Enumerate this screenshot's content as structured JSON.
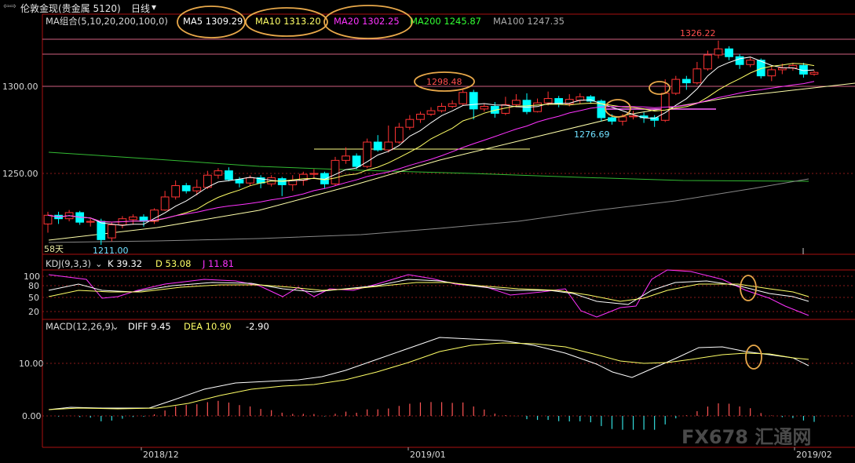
{
  "window": {
    "nav_arrows": "⇦⇨",
    "title": "伦敦金现(贵金属 5120)",
    "period": "日线",
    "period_caret": "▾"
  },
  "price_panel": {
    "ma_label": "MA组合(5,10,20,200,100,0)",
    "ma_items": [
      {
        "label": "MA5",
        "value": "1309.29",
        "color": "#ffffff"
      },
      {
        "label": "MA10",
        "value": "1313.20",
        "color": "#ffff66"
      },
      {
        "label": "MA20",
        "value": "1302.25",
        "color": "#ff33ff"
      },
      {
        "label": "MA200",
        "value": "1245.87",
        "color": "#33ff33"
      },
      {
        "label": "MA100",
        "value": "1247.35",
        "color": "#aaaaaa"
      }
    ],
    "y_ticks": [
      "1300.00",
      "1250.00"
    ],
    "annotations": {
      "high": "1326.22",
      "peak1": "1298.48",
      "low_mid": "1276.69",
      "low": "1211.00",
      "days": "58天"
    }
  },
  "kdj_panel": {
    "label": "KDJ(9,3,3)",
    "k": "K 39.32",
    "d": "D 53.08",
    "j": "J 11.81",
    "y_ticks": [
      "100",
      "80",
      "50",
      "20"
    ]
  },
  "macd_panel": {
    "label": "MACD(12,26,9)",
    "diff": "DIFF 9.45",
    "dea": "DEA 10.90",
    "macd": "-2.90",
    "y_ticks": [
      "10.00",
      "0.00"
    ]
  },
  "x_axis": {
    "labels": [
      "2018/12",
      "2019/01",
      "2019/02"
    ]
  },
  "watermark": "FX678 汇通网",
  "colors": {
    "up": "#ff3333",
    "down": "#00ffff",
    "bg": "#000000",
    "grid": "#8b0000",
    "highlight": "#e8a84a"
  },
  "chart_data": {
    "type": "candlestick",
    "ylim": [
      1195,
      1340
    ],
    "candles": [
      [
        1221.0,
        1226.0,
        1216.0,
        1228.0
      ],
      [
        1226.0,
        1224.0,
        1221.0,
        1228.0
      ],
      [
        1224.0,
        1227.5,
        1222.5,
        1229.0
      ],
      [
        1227.5,
        1222.0,
        1220.5,
        1228.5
      ],
      [
        1222.0,
        1222.5,
        1219.5,
        1224.0
      ],
      [
        1222.5,
        1212.0,
        1209.0,
        1224.0
      ],
      [
        1213.0,
        1220.5,
        1211.0,
        1222.0
      ],
      [
        1220.5,
        1224.0,
        1218.5,
        1225.5
      ],
      [
        1223.5,
        1225.0,
        1220.5,
        1226.5
      ],
      [
        1225.0,
        1222.5,
        1219.5,
        1226.5
      ],
      [
        1222.5,
        1229.0,
        1221.0,
        1230.0
      ],
      [
        1229.0,
        1236.5,
        1228.5,
        1240.0
      ],
      [
        1236.5,
        1243.0,
        1235.0,
        1246.0
      ],
      [
        1243.0,
        1240.0,
        1238.5,
        1244.5
      ],
      [
        1240.0,
        1242.0,
        1237.5,
        1246.5
      ],
      [
        1242.0,
        1249.0,
        1241.0,
        1251.5
      ],
      [
        1249.0,
        1251.5,
        1247.0,
        1253.0
      ],
      [
        1251.5,
        1246.5,
        1245.5,
        1253.5
      ],
      [
        1246.5,
        1244.5,
        1242.0,
        1248.0
      ],
      [
        1244.5,
        1247.5,
        1243.0,
        1249.0
      ],
      [
        1247.5,
        1244.5,
        1241.5,
        1249.0
      ],
      [
        1244.0,
        1247.5,
        1242.5,
        1249.0
      ],
      [
        1247.0,
        1243.5,
        1237.0,
        1248.0
      ],
      [
        1243.5,
        1246.0,
        1240.0,
        1249.0
      ],
      [
        1246.0,
        1249.5,
        1243.0,
        1251.0
      ],
      [
        1249.5,
        1250.0,
        1247.0,
        1252.5
      ],
      [
        1250.0,
        1244.0,
        1241.5,
        1251.0
      ],
      [
        1244.0,
        1257.5,
        1243.0,
        1259.5
      ],
      [
        1257.5,
        1260.0,
        1255.5,
        1265.0
      ],
      [
        1260.0,
        1254.0,
        1252.5,
        1261.5
      ],
      [
        1254.0,
        1268.0,
        1253.0,
        1270.0
      ],
      [
        1268.0,
        1263.5,
        1262.5,
        1272.0
      ],
      [
        1263.5,
        1268.0,
        1262.0,
        1277.5
      ],
      [
        1268.0,
        1276.5,
        1267.0,
        1279.0
      ],
      [
        1276.5,
        1281.0,
        1275.0,
        1283.5
      ],
      [
        1281.0,
        1284.0,
        1279.0,
        1285.5
      ],
      [
        1284.0,
        1286.0,
        1283.0,
        1288.0
      ],
      [
        1286.0,
        1288.5,
        1285.0,
        1290.5
      ],
      [
        1288.5,
        1290.0,
        1287.5,
        1292.0
      ],
      [
        1290.0,
        1296.5,
        1289.0,
        1298.48
      ],
      [
        1296.5,
        1287.0,
        1281.0,
        1298.0
      ],
      [
        1287.0,
        1288.5,
        1285.5,
        1290.0
      ],
      [
        1288.5,
        1284.5,
        1282.0,
        1291.0
      ],
      [
        1284.5,
        1289.5,
        1283.5,
        1294.0
      ],
      [
        1289.5,
        1292.0,
        1288.0,
        1295.5
      ],
      [
        1292.0,
        1285.5,
        1284.0,
        1296.0
      ],
      [
        1285.5,
        1290.5,
        1285.0,
        1293.0
      ],
      [
        1290.5,
        1293.0,
        1289.0,
        1297.0
      ],
      [
        1293.0,
        1290.0,
        1288.0,
        1294.5
      ],
      [
        1290.0,
        1292.5,
        1288.5,
        1295.5
      ],
      [
        1292.0,
        1294.0,
        1290.0,
        1296.0
      ],
      [
        1294.0,
        1291.5,
        1290.0,
        1295.0
      ],
      [
        1291.5,
        1282.0,
        1280.0,
        1292.5
      ],
      [
        1282.0,
        1280.0,
        1278.0,
        1284.0
      ],
      [
        1280.0,
        1282.5,
        1277.5,
        1284.0
      ],
      [
        1282.5,
        1283.0,
        1281.0,
        1286.0
      ],
      [
        1283.0,
        1282.0,
        1279.0,
        1285.0
      ],
      [
        1282.0,
        1280.5,
        1276.69,
        1283.5
      ],
      [
        1280.5,
        1296.0,
        1279.5,
        1304.0
      ],
      [
        1296.0,
        1304.0,
        1295.0,
        1306.0
      ],
      [
        1304.0,
        1302.0,
        1298.0,
        1306.0
      ],
      [
        1302.0,
        1310.0,
        1301.0,
        1314.0
      ],
      [
        1310.0,
        1318.0,
        1309.0,
        1320.5
      ],
      [
        1318.0,
        1321.5,
        1316.0,
        1326.22
      ],
      [
        1321.5,
        1317.0,
        1315.0,
        1323.0
      ],
      [
        1317.0,
        1312.5,
        1310.0,
        1318.5
      ],
      [
        1312.5,
        1315.0,
        1311.0,
        1316.5
      ],
      [
        1315.0,
        1306.0,
        1304.5,
        1316.0
      ],
      [
        1306.0,
        1309.5,
        1303.0,
        1311.5
      ],
      [
        1309.5,
        1310.5,
        1307.0,
        1313.0
      ],
      [
        1310.5,
        1312.0,
        1309.0,
        1313.5
      ],
      [
        1312.0,
        1307.0,
        1305.0,
        1313.5
      ],
      [
        1307.0,
        1308.0,
        1306.0,
        1309.0
      ]
    ]
  }
}
